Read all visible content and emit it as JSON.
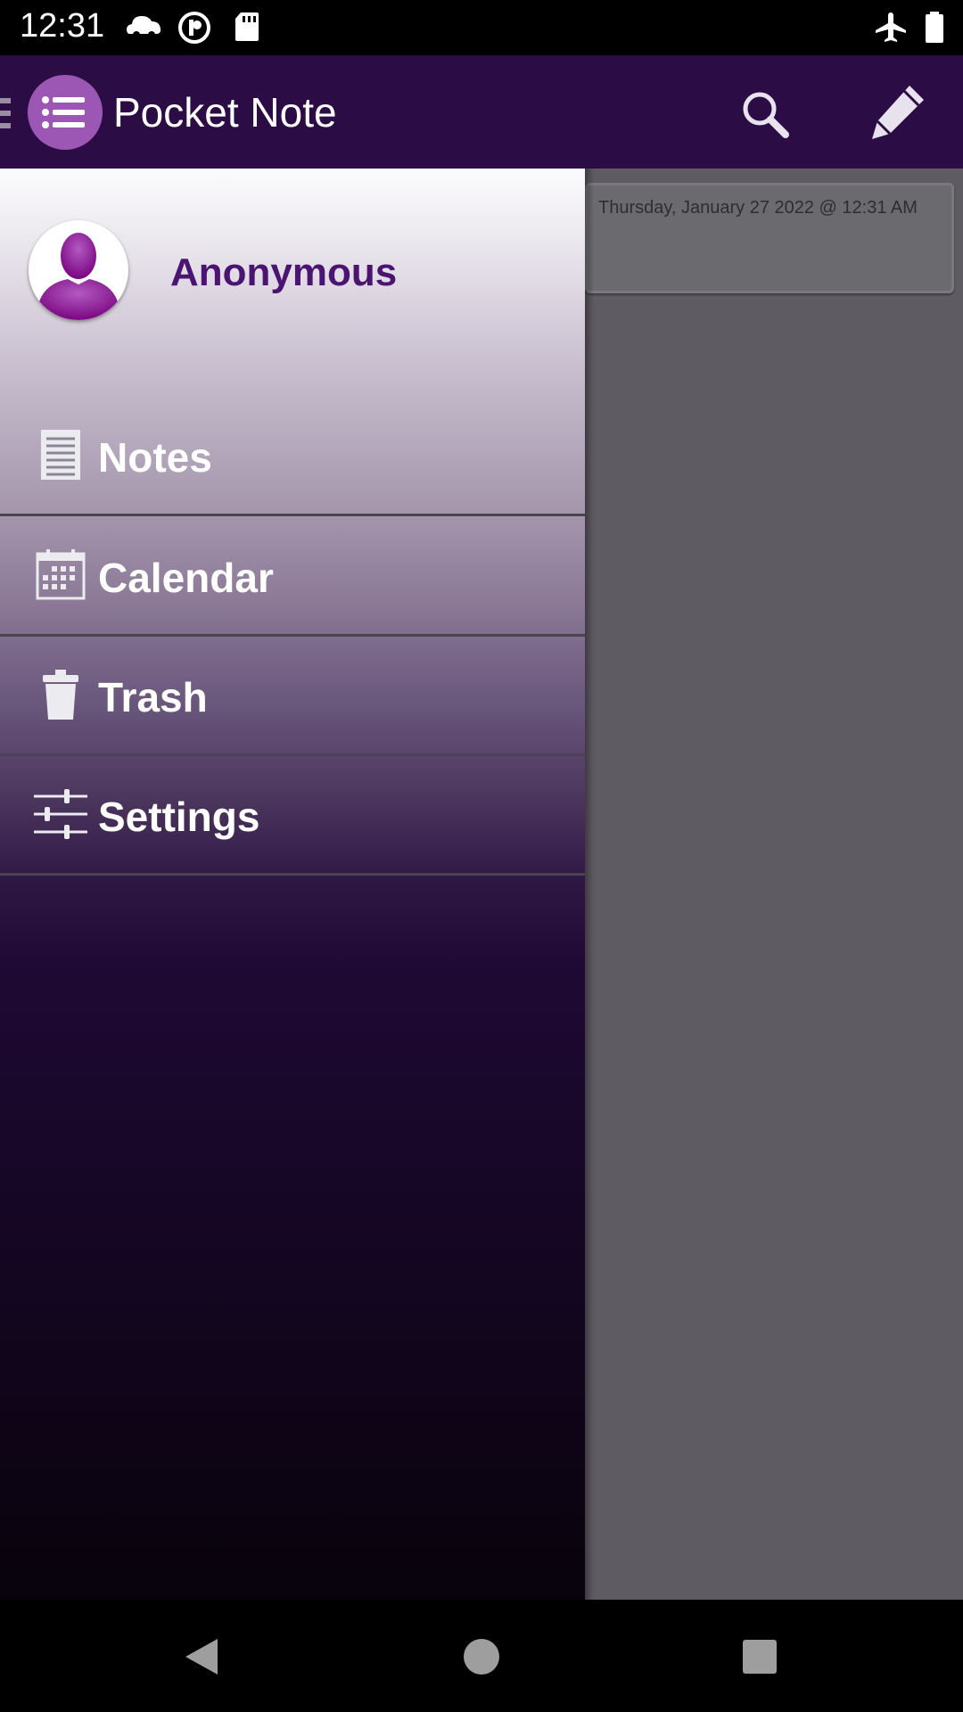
{
  "status_bar": {
    "time": "12:31",
    "left_icons": [
      "cloud-car-icon",
      "circle-p-icon",
      "sd-card-icon"
    ],
    "right_icons": [
      "airplane-mode-icon",
      "battery-icon"
    ]
  },
  "app_bar": {
    "title": "Pocket Note",
    "icons": [
      "menu-icon",
      "app-list-logo-icon",
      "search-icon",
      "pencil-icon"
    ]
  },
  "drawer": {
    "profile_name": "Anonymous",
    "items": [
      {
        "label": "Notes",
        "icon": "notes-icon"
      },
      {
        "label": "Calendar",
        "icon": "calendar-icon"
      },
      {
        "label": "Trash",
        "icon": "trash-icon"
      },
      {
        "label": "Settings",
        "icon": "sliders-icon"
      }
    ]
  },
  "notes": [
    {
      "date": "Thursday, January 27 2022 @ 12:31 AM"
    }
  ],
  "nav_bar": {
    "icons": [
      "back-icon",
      "home-icon",
      "recents-icon"
    ]
  },
  "colors": {
    "app_bar": "#2b0c45",
    "accent": "#9c57b5",
    "profile_name": "#4a1470",
    "scrim": "#5e5c62"
  }
}
